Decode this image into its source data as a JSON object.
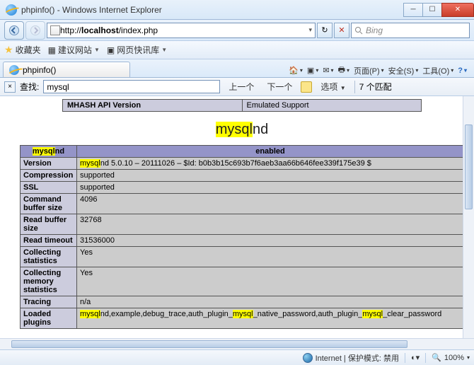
{
  "window": {
    "title": "phpinfo() - Windows Internet Explorer"
  },
  "nav": {
    "url": "http://localhost/index.php",
    "url_bold": "localhost",
    "search_placeholder": "Bing"
  },
  "favbar": {
    "label": "收藏夹",
    "suggested": "建议网站",
    "quick": "网页快讯库"
  },
  "tab": {
    "title": "phpinfo()"
  },
  "toolbar": {
    "page": "页面(P)",
    "safety": "安全(S)",
    "tools": "工具(O)"
  },
  "find": {
    "label": "查找:",
    "value": "mysql",
    "prev": "上一个",
    "next": "下一个",
    "options": "选项",
    "matches": "7 个匹配"
  },
  "top_table": {
    "left": "MHASH API Version",
    "right": "Emulated Support"
  },
  "section": {
    "hl": "mysql",
    "rest": "nd"
  },
  "tbl": {
    "h1_hl": "mysql",
    "h1_rest": "nd",
    "h2": "enabled",
    "rows": [
      {
        "k": "Version",
        "hl1": "mysql",
        "v": "nd 5.0.10 – 20111026 – $Id: b0b3b15c693b7f6aeb3aa66b646fee339f175e39 $"
      },
      {
        "k": "Compression",
        "v": "supported"
      },
      {
        "k": "SSL",
        "v": "supported"
      },
      {
        "k": "Command buffer size",
        "v": "4096"
      },
      {
        "k": "Read buffer size",
        "v": "32768"
      },
      {
        "k": "Read timeout",
        "v": "31536000"
      },
      {
        "k": "Collecting statistics",
        "v": "Yes"
      },
      {
        "k": "Collecting memory statistics",
        "v": "Yes"
      },
      {
        "k": "Tracing",
        "v": "n/a"
      },
      {
        "k": "Loaded plugins",
        "hl1": "mysql",
        "mid1": "nd,example,debug_trace,auth_plugin_",
        "hl2": "mysql",
        "mid2": "_native_password,auth_plugin_",
        "hl3": "mysql",
        "end": "_clear_password"
      }
    ]
  },
  "status": {
    "mode": "Internet | 保护模式: 禁用",
    "zoom": "100%"
  }
}
